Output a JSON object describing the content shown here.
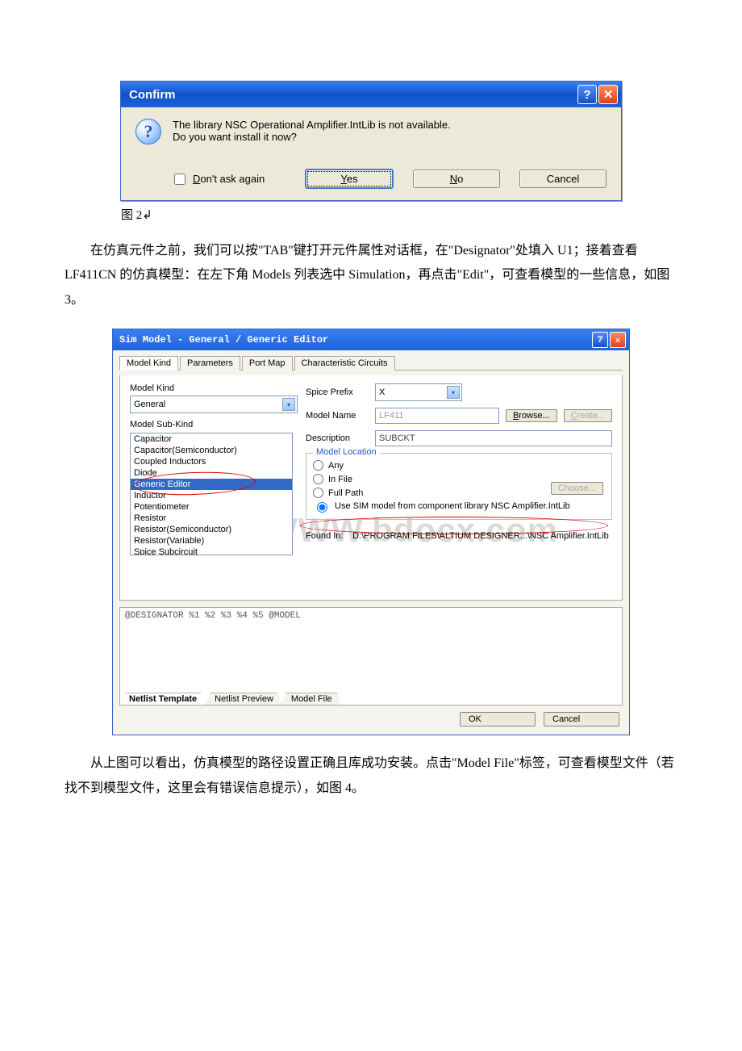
{
  "confirm_dialog": {
    "title": "Confirm",
    "message_line1": "The library NSC Operational Amplifier.IntLib is not available.",
    "message_line2": "Do you want install it now?",
    "dont_ask_label": "Don't ask again",
    "yes_label": "Yes",
    "no_label": "No",
    "cancel_label": "Cancel"
  },
  "caption_fig2": "图 2↲",
  "para1": "在仿真元件之前，我们可以按\"TAB\"键打开元件属性对话框，在\"Designator\"处填入 U1；接着查看 LF411CN 的仿真模型：在左下角 Models 列表选中 Simulation，再点击\"Edit\"，可查看模型的一些信息，如图 3。",
  "sim_dialog": {
    "title": "Sim Model - General / Generic Editor",
    "tabs": [
      "Model Kind",
      "Parameters",
      "Port Map",
      "Characteristic Circuits"
    ],
    "model_kind_label": "Model Kind",
    "model_kind_value": "General",
    "model_subkind_label": "Model Sub-Kind",
    "subkind_items": [
      "Capacitor",
      "Capacitor(Semiconductor)",
      "Coupled Inductors",
      "Diode",
      "Generic Editor",
      "Inductor",
      "Potentiometer",
      "Resistor",
      "Resistor(Semiconductor)",
      "Resistor(Variable)",
      "Spice Subcircuit"
    ],
    "subkind_selected_index": 4,
    "spice_prefix_label": "Spice Prefix",
    "spice_prefix_value": "X",
    "model_name_label": "Model Name",
    "model_name_value": "LF411",
    "browse_label": "Browse...",
    "create_label": "Create...",
    "description_label": "Description",
    "description_value": "SUBCKT",
    "model_location_label": "Model Location",
    "loc_any": "Any",
    "loc_infile": "In File",
    "loc_fullpath": "Full Path",
    "choose_label": "Choose...",
    "loc_usesim": "Use SIM model from component library NSC Amplifier.IntLib",
    "found_in_label": "Found In:",
    "found_in_value": "D:\\PROGRAM FILES\\ALTIUM DESIGNER...\\NSC Amplifier.IntLib",
    "netlist_text": "@DESIGNATOR %1 %2 %3 %4 %5 @MODEL",
    "bottom_tabs": [
      "Netlist Template",
      "Netlist Preview",
      "Model File"
    ],
    "ok_label": "OK",
    "cancel_label": "Cancel"
  },
  "watermark": "WWW.bdocx.com",
  "para2": "从上图可以看出，仿真模型的路径设置正确且库成功安装。点击\"Model File\"标签，可查看模型文件（若找不到模型文件，这里会有错误信息提示），如图 4。"
}
